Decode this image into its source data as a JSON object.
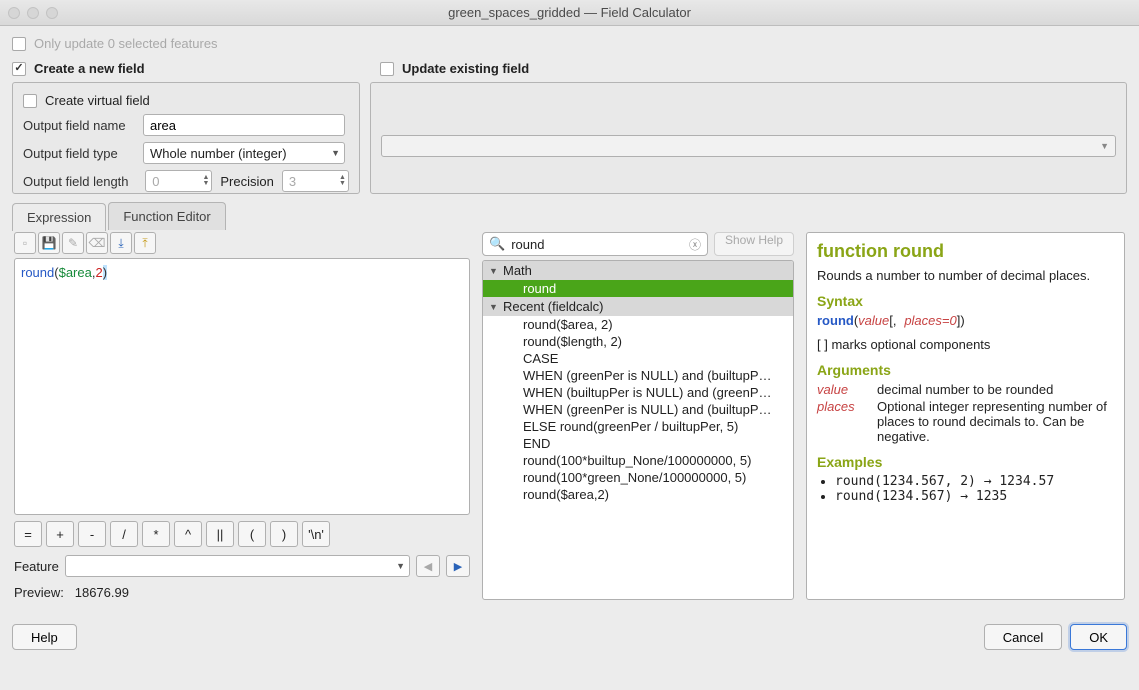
{
  "window": {
    "title": "green_spaces_gridded — Field Calculator"
  },
  "top": {
    "only_update_label": "Only update 0 selected features",
    "create_new_label": "Create a new field",
    "update_existing_label": "Update existing field"
  },
  "left_panel": {
    "create_virtual_label": "Create virtual field",
    "name_label": "Output field name",
    "name_value": "area",
    "type_label": "Output field type",
    "type_value": "Whole number (integer)",
    "length_label": "Output field length",
    "length_value": "0",
    "precision_label": "Precision",
    "precision_value": "3"
  },
  "tabs": {
    "expression": "Expression",
    "func_editor": "Function Editor"
  },
  "editor": {
    "fn": "round",
    "open": "(",
    "var": "$area",
    "comma": ",",
    "num": "2",
    "close": ")",
    "operators": [
      "=",
      "+",
      "-",
      "/",
      "*",
      "^",
      "||",
      "(",
      ")",
      "'\\n'"
    ]
  },
  "feature": {
    "label": "Feature"
  },
  "preview": {
    "label": "Preview:",
    "value": "18676.99"
  },
  "search": {
    "value": "round",
    "show_help": "Show Help"
  },
  "tree": {
    "group_math": "Math",
    "sel_item": "round",
    "group_recent": "Recent (fieldcalc)",
    "items": [
      "round($area, 2)",
      "round($length, 2)",
      "CASE",
      "WHEN (greenPer is NULL) and (builtupP…",
      "WHEN (builtupPer is NULL) and (greenP…",
      "WHEN (greenPer is NULL) and (builtupP…",
      "ELSE round(greenPer / builtupPer, 5)",
      "END",
      "round(100*builtup_None/100000000, 5)",
      "round(100*green_None/100000000, 5)",
      "round($area,2)"
    ]
  },
  "help": {
    "title": "function round",
    "desc": "Rounds a number to number of decimal places.",
    "syntax_h": "Syntax",
    "syn_fn": "round",
    "syn_open": "(",
    "syn_a1": "value",
    "syn_mid": "[,",
    "syn_a2": "places=0",
    "syn_close": "])",
    "opt_note": "[ ] marks optional components",
    "args_h": "Arguments",
    "arg1_n": "value",
    "arg1_d": "decimal number to be rounded",
    "arg2_n": "places",
    "arg2_d": "Optional integer representing number of places to round decimals to. Can be negative.",
    "ex_h": "Examples",
    "ex1": "round(1234.567, 2) → 1234.57",
    "ex2": "round(1234.567) → 1235"
  },
  "footer": {
    "help": "Help",
    "cancel": "Cancel",
    "ok": "OK"
  }
}
